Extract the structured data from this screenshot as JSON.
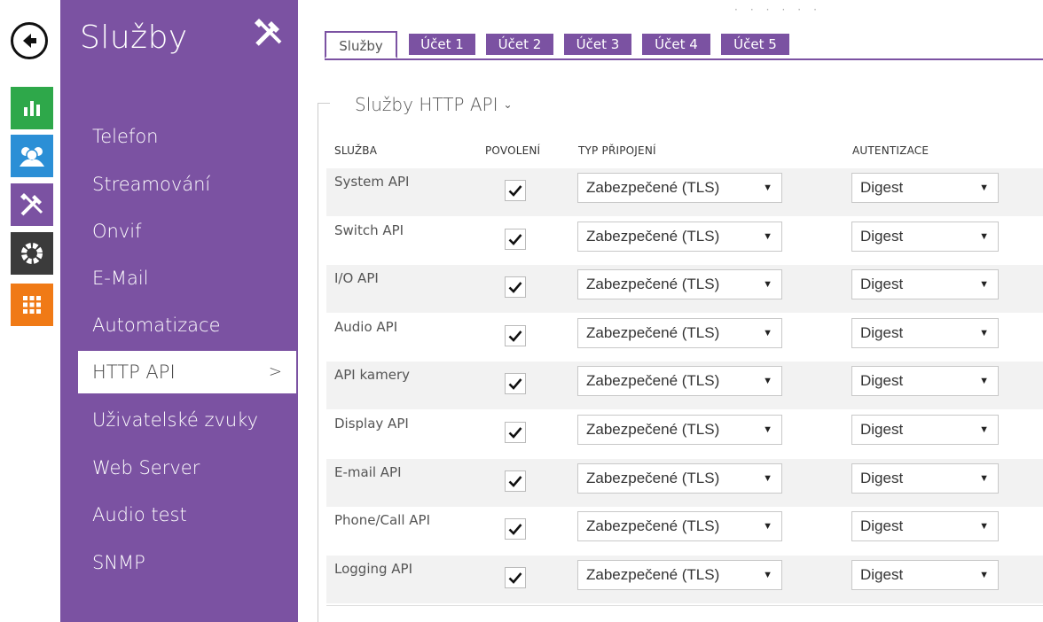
{
  "nav": {
    "back_label": "",
    "rail_icons": [
      {
        "name": "status-icon",
        "color": "#2ea84a"
      },
      {
        "name": "directory-icon",
        "color": "#2b8fd6"
      },
      {
        "name": "services-icon",
        "color": "#7b52a2"
      },
      {
        "name": "hardware-icon",
        "color": "#3b3b3b"
      },
      {
        "name": "system-icon",
        "color": "#f07a16"
      }
    ]
  },
  "sidebar": {
    "title": "Služby",
    "items": [
      {
        "label": "Telefon"
      },
      {
        "label": "Streamování"
      },
      {
        "label": "Onvif"
      },
      {
        "label": "E-Mail"
      },
      {
        "label": "Automatizace"
      },
      {
        "label": "HTTP API",
        "active": true,
        "chevron": ">"
      },
      {
        "label": "Uživatelské zvuky"
      },
      {
        "label": "Web Server"
      },
      {
        "label": "Audio test"
      },
      {
        "label": "SNMP"
      }
    ]
  },
  "tabs": [
    {
      "label": "Služby",
      "active": true
    },
    {
      "label": "Účet 1"
    },
    {
      "label": "Účet 2"
    },
    {
      "label": "Účet 3"
    },
    {
      "label": "Účet 4"
    },
    {
      "label": "Účet 5"
    }
  ],
  "section": {
    "title": "Služby HTTP API",
    "caret": "⌄"
  },
  "table": {
    "headers": {
      "service": "SLUŽBA",
      "enabled": "POVOLENÍ",
      "connection": "TYP PŘIPOJENÍ",
      "auth": "AUTENTIZACE"
    },
    "rows": [
      {
        "service": "System API",
        "enabled": true,
        "connection": "Zabezpečené (TLS)",
        "auth": "Digest"
      },
      {
        "service": "Switch API",
        "enabled": true,
        "connection": "Zabezpečené (TLS)",
        "auth": "Digest"
      },
      {
        "service": "I/O API",
        "enabled": true,
        "connection": "Zabezpečené (TLS)",
        "auth": "Digest"
      },
      {
        "service": "Audio API",
        "enabled": true,
        "connection": "Zabezpečené (TLS)",
        "auth": "Digest"
      },
      {
        "service": "API kamery",
        "enabled": true,
        "connection": "Zabezpečené (TLS)",
        "auth": "Digest"
      },
      {
        "service": "Display API",
        "enabled": true,
        "connection": "Zabezpečené (TLS)",
        "auth": "Digest"
      },
      {
        "service": "E-mail API",
        "enabled": true,
        "connection": "Zabezpečené (TLS)",
        "auth": "Digest"
      },
      {
        "service": "Phone/Call API",
        "enabled": true,
        "connection": "Zabezpečené (TLS)",
        "auth": "Digest"
      },
      {
        "service": "Logging API",
        "enabled": true,
        "connection": "Zabezpečené (TLS)",
        "auth": "Digest"
      }
    ]
  },
  "colors": {
    "accent": "#7b52a2"
  }
}
